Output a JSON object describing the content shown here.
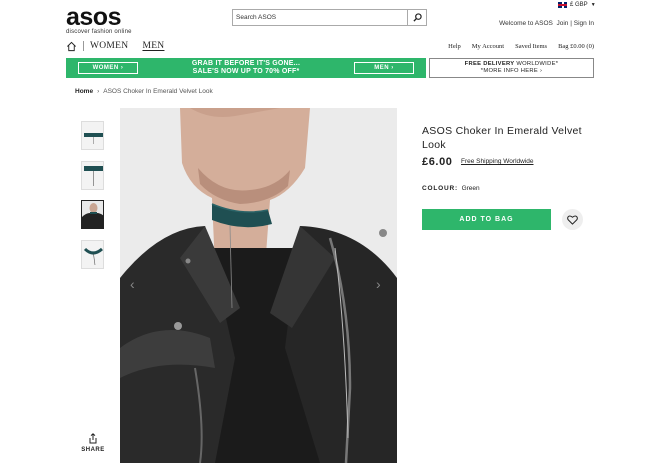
{
  "brand": {
    "logo": "asos",
    "tagline": "discover fashion online"
  },
  "search": {
    "placeholder": "Search ASOS"
  },
  "currency": {
    "label": "£ GBP",
    "flag": "uk-flag-icon"
  },
  "account": {
    "welcome": "Welcome to ASOS",
    "join": "Join",
    "separator": "|",
    "signin": "Sign In"
  },
  "nav": {
    "women": "WOMEN",
    "men": "MEN"
  },
  "utils": {
    "help": "Help",
    "my_account": "My Account",
    "saved_items": "Saved Items",
    "bag": "Bag £0.00 (0)"
  },
  "promo": {
    "women_btn": "WOMEN ›",
    "men_btn": "MEN ›",
    "line1": "GRAB IT BEFORE IT'S GONE...",
    "line2": "SALE'S NOW UP TO 70% OFF*",
    "color": "#2eb66b"
  },
  "delivery": {
    "bold": "FREE DELIVERY",
    "rest": " WORLDWIDE*",
    "more": "*MORE INFO HERE ›"
  },
  "breadcrumb": {
    "home": "Home",
    "sep": "›",
    "current": "ASOS Choker In Emerald Velvet Look"
  },
  "share": {
    "label": "SHARE"
  },
  "product": {
    "title": "ASOS Choker In Emerald Velvet Look",
    "price": "£6.00",
    "shipping": "Free Shipping Worldwide",
    "colour_label": "COLOUR:",
    "colour_value": "Green",
    "add_to_bag": "ADD TO BAG",
    "choker_color": "#1f4f52"
  }
}
